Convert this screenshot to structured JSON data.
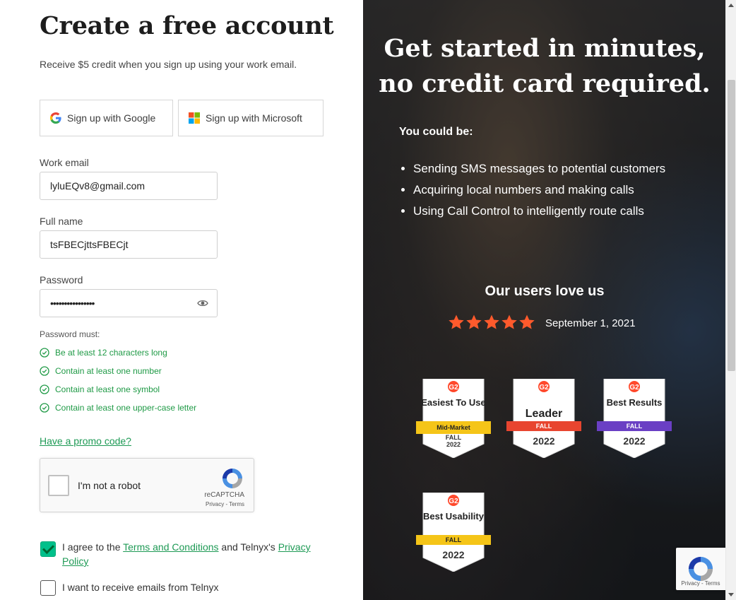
{
  "form": {
    "title": "Create a free account",
    "subtitle": "Receive $5 credit when you sign up using your work email.",
    "sso_google": "Sign up with Google",
    "sso_microsoft": "Sign up with Microsoft",
    "email_label": "Work email",
    "email_value": "lyluEQv8@gmail.com",
    "name_label": "Full name",
    "name_value": "tsFBECjttsFBECjt",
    "password_label": "Password",
    "password_value": "••••••••••••••••",
    "password_must": "Password must:",
    "rules": [
      "Be at least 12 characters long",
      "Contain at least one number",
      "Contain at least one symbol",
      "Contain at least one upper-case letter"
    ],
    "promo": "Have a promo code?",
    "captcha_label": "I'm not a robot",
    "captcha_brand": "reCAPTCHA",
    "captcha_links": "Privacy - Terms",
    "agree_prefix": "I agree to the ",
    "agree_terms": "Terms and Conditions",
    "agree_middle": " and Telnyx's ",
    "agree_privacy": "Privacy Policy",
    "agree_checked": true,
    "emails_label": "I want to receive emails from Telnyx",
    "emails_checked": false
  },
  "panel": {
    "headline_line1": "Get started in minutes,",
    "headline_line2": "no credit card required.",
    "could_be": "You could be:",
    "bullets": [
      "Sending SMS messages to potential customers",
      "Acquiring local numbers and making calls",
      "Using Call Control to intelligently route calls"
    ],
    "love": "Our users love us",
    "rating_stars": 5,
    "rating_date": "September 1, 2021",
    "badges": [
      {
        "title": "Easiest To Use",
        "sub": "Mid-Market",
        "season": "FALL",
        "year": "2022",
        "ribbon_color": "#f5c518"
      },
      {
        "title": "Leader",
        "sub": "",
        "season": "FALL",
        "year": "2022",
        "ribbon_color": "#e8452f"
      },
      {
        "title": "Best Results",
        "sub": "",
        "season": "FALL",
        "year": "2022",
        "ribbon_color": "#6a3fc4"
      },
      {
        "title": "Best Usability",
        "sub": "",
        "season": "FALL",
        "year": "2022",
        "ribbon_color": "#f5c518"
      }
    ]
  },
  "colors": {
    "accent": "#1e9a55",
    "check": "#00c08b",
    "g2_red": "#ff492c"
  }
}
